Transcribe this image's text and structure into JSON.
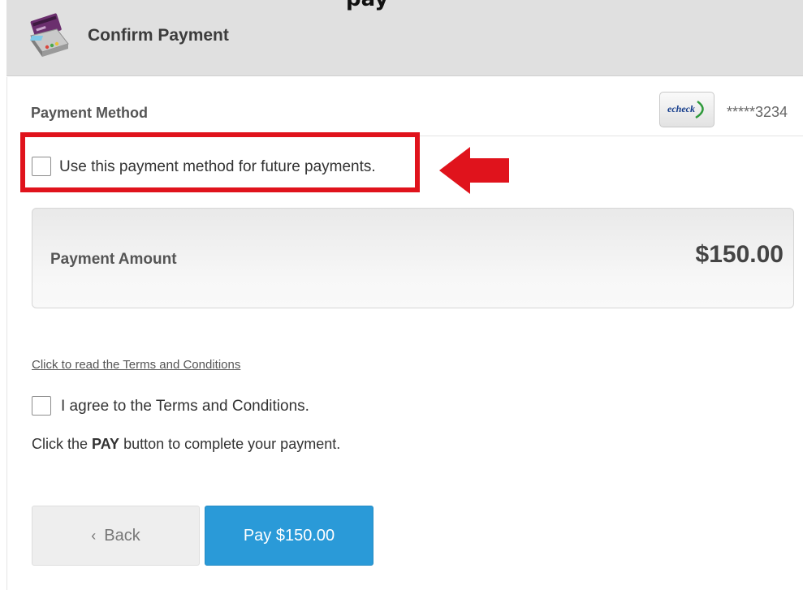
{
  "header": {
    "clipped_top_text": "pay",
    "icon": "payment-terminal-icon",
    "title": "Confirm Payment"
  },
  "payment_method": {
    "label": "Payment Method",
    "badge_text": "echeck",
    "masked_account": "*****3234"
  },
  "future_payments": {
    "label": "Use this payment method for future payments.",
    "checked": false
  },
  "annotation": {
    "highlight_color": "#e0131c",
    "arrow_icon": "left-arrow-icon"
  },
  "amount": {
    "label": "Payment Amount",
    "value": "$150.00"
  },
  "terms": {
    "link_text": "Click to read the Terms and Conditions",
    "agree_label": "I agree to the Terms and Conditions.",
    "checked": false
  },
  "instruction": {
    "before": "Click the ",
    "emphasis": "PAY",
    "after": " button to complete your payment."
  },
  "buttons": {
    "back_label": "Back",
    "pay_label": "Pay $150.00"
  },
  "colors": {
    "pay_button": "#2a9ad8",
    "header_bg": "#e0e0e0"
  }
}
